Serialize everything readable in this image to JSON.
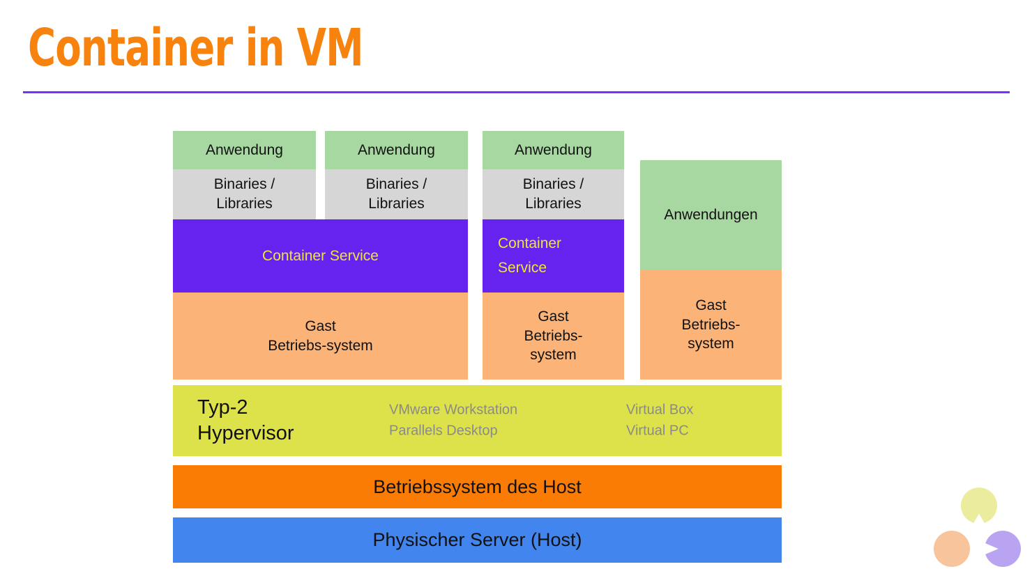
{
  "slide": {
    "title": "Container in VM",
    "title_color": "#f7820d",
    "rule_color": "#7a2dff"
  },
  "diagram": {
    "columns": [
      {
        "id": "col-1",
        "app": "Anwendung",
        "bins": "Binaries /\nLibraries"
      },
      {
        "id": "col-2",
        "app": "Anwendung",
        "bins": "Binaries /\nLibraries"
      },
      {
        "id": "col-3",
        "app": "Anwendung",
        "bins": "Binaries /\nLibraries",
        "container_service": "Container\nService",
        "guest_os": "Gast\nBetriebs-\nsystem"
      },
      {
        "id": "col-4",
        "app": "Anwendungen",
        "guest_os": "Gast\nBetriebs-\nsystem"
      }
    ],
    "container_service_wide": "Container Service",
    "guest_os_wide": "Gast\nBetriebs-system",
    "hypervisor": {
      "label": "Typ-2\nHypervisor",
      "products_col_a": "VMware Workstation\nParallels Desktop",
      "products_col_b": "Virtual Box\nVirtual PC",
      "bg_color": "#dde24a",
      "product_text_color": "#8a8a8a"
    },
    "host_os": {
      "label": "Betriebssystem des Host",
      "bg_color": "#fb7c05"
    },
    "physical_server": {
      "label": "Physischer Server (Host)",
      "bg_color": "#4285ef"
    },
    "colors": {
      "app_green": "#a8d8a2",
      "bins_gray": "#d6d6d6",
      "container_purple": "#6622ee",
      "container_text_yellow": "#e8e83c",
      "guest_os_orange": "#fbb377"
    }
  },
  "decor": {
    "shapes": [
      {
        "name": "pac-top",
        "color": "#ecec9e"
      },
      {
        "name": "pac-left",
        "color": "#f8c49b"
      },
      {
        "name": "pac-right",
        "color": "#b8a4f0"
      }
    ]
  }
}
